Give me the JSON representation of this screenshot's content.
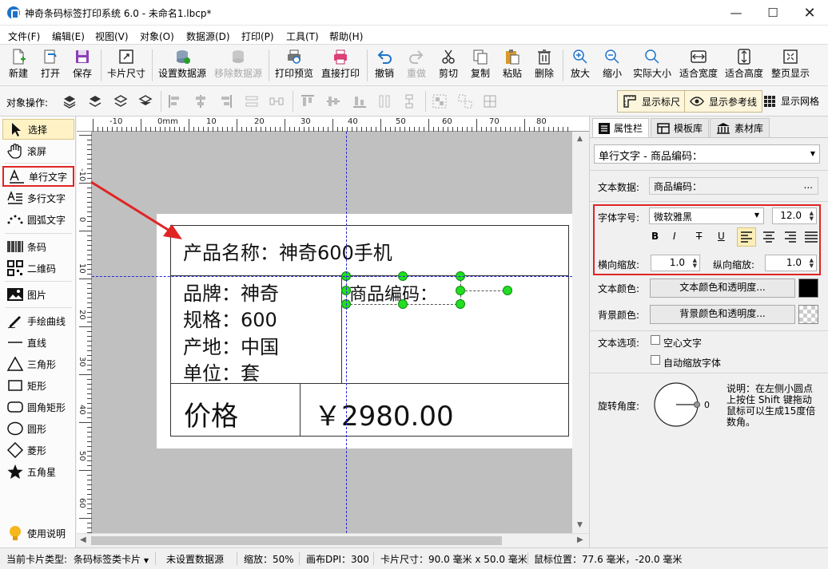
{
  "window": {
    "title": "神奇条码标签打印系统 6.0 - 未命名1.lbcp*"
  },
  "menu": [
    "文件(F)",
    "编辑(E)",
    "视图(V)",
    "对象(O)",
    "数据源(D)",
    "打印(P)",
    "工具(T)",
    "帮助(H)"
  ],
  "toolbar": [
    {
      "label": "新建",
      "icon": "new-file-icon",
      "enabled": true
    },
    {
      "label": "打开",
      "icon": "open-icon",
      "enabled": true
    },
    {
      "label": "保存",
      "icon": "save-icon",
      "enabled": true
    },
    {
      "label": "卡片尺寸",
      "icon": "card-size-icon",
      "enabled": true
    },
    {
      "label": "设置数据源",
      "icon": "database-icon",
      "enabled": true
    },
    {
      "label": "移除数据源",
      "icon": "remove-database-icon",
      "enabled": false
    },
    {
      "label": "打印预览",
      "icon": "print-preview-icon",
      "enabled": true
    },
    {
      "label": "直接打印",
      "icon": "printer-icon",
      "enabled": true
    },
    {
      "label": "撤销",
      "icon": "undo-icon",
      "enabled": true
    },
    {
      "label": "重做",
      "icon": "redo-icon",
      "enabled": false
    },
    {
      "label": "剪切",
      "icon": "scissors-icon",
      "enabled": true
    },
    {
      "label": "复制",
      "icon": "copy-icon",
      "enabled": true
    },
    {
      "label": "粘贴",
      "icon": "paste-icon",
      "enabled": true
    },
    {
      "label": "删除",
      "icon": "trash-icon",
      "enabled": true
    },
    {
      "label": "放大",
      "icon": "zoom-in-icon",
      "enabled": true
    },
    {
      "label": "缩小",
      "icon": "zoom-out-icon",
      "enabled": true
    },
    {
      "label": "实际大小",
      "icon": "actual-size-icon",
      "enabled": true
    },
    {
      "label": "适合宽度",
      "icon": "fit-width-icon",
      "enabled": true
    },
    {
      "label": "适合高度",
      "icon": "fit-height-icon",
      "enabled": true
    },
    {
      "label": "整页显示",
      "icon": "full-page-icon",
      "enabled": true
    }
  ],
  "objbar": {
    "label": "对象操作:",
    "toggles": [
      {
        "label": "显示标尺",
        "icon": "ruler-icon",
        "active": true
      },
      {
        "label": "显示参考线",
        "icon": "eye-icon",
        "active": true
      },
      {
        "label": "显示网格",
        "icon": "grid-icon",
        "active": false
      }
    ]
  },
  "tools": [
    {
      "label": "选择",
      "icon": "arrow-cursor-icon",
      "state": "selected"
    },
    {
      "label": "滚屏",
      "icon": "hand-icon",
      "state": ""
    },
    {
      "label": "单行文字",
      "icon": "single-line-text-icon",
      "state": "highlighted"
    },
    {
      "label": "多行文字",
      "icon": "multi-line-text-icon",
      "state": ""
    },
    {
      "label": "圆弧文字",
      "icon": "arc-text-icon",
      "state": ""
    },
    {
      "label": "条码",
      "icon": "barcode-icon",
      "state": ""
    },
    {
      "label": "二维码",
      "icon": "qrcode-icon",
      "state": ""
    },
    {
      "label": "图片",
      "icon": "image-icon",
      "state": ""
    },
    {
      "label": "手绘曲线",
      "icon": "pen-icon",
      "state": ""
    },
    {
      "label": "直线",
      "icon": "line-icon",
      "state": ""
    },
    {
      "label": "三角形",
      "icon": "triangle-icon",
      "state": ""
    },
    {
      "label": "矩形",
      "icon": "rectangle-icon",
      "state": ""
    },
    {
      "label": "圆角矩形",
      "icon": "rounded-rectangle-icon",
      "state": ""
    },
    {
      "label": "圆形",
      "icon": "circle-icon",
      "state": ""
    },
    {
      "label": "菱形",
      "icon": "diamond-icon",
      "state": ""
    },
    {
      "label": "五角星",
      "icon": "star-icon",
      "state": ""
    },
    {
      "label": "使用说明",
      "icon": "lightbulb-icon",
      "state": ""
    }
  ],
  "ruler": {
    "top": [
      "-10",
      "0mm",
      "10",
      "20",
      "30",
      "40",
      "50",
      "60",
      "70",
      "80"
    ],
    "left": [
      "-10",
      "0",
      "10",
      "20",
      "30",
      "40",
      "50",
      "60"
    ]
  },
  "card": {
    "product_name": "产品名称：神奇600手机",
    "brand": "品牌：神奇",
    "spec": "规格：600",
    "origin": "产地：中国",
    "unit": "单位：套",
    "selected_text": "商品编码：",
    "price_label": "价格",
    "price_value": "￥2980.00"
  },
  "right": {
    "tabs": [
      {
        "label": "属性栏",
        "icon": "list-icon",
        "active": true
      },
      {
        "label": "模板库",
        "icon": "template-icon",
        "active": false
      },
      {
        "label": "素材库",
        "icon": "library-icon",
        "active": false
      }
    ],
    "object_select": "单行文字 - 商品编码：",
    "text_data_label": "文本数据:",
    "text_data_value": "商品编码：",
    "text_data_more": "...",
    "font_label": "字体字号:",
    "font_name": "微软雅黑",
    "font_size": "12.0",
    "style_buttons": [
      "B",
      "I",
      "T",
      "U"
    ],
    "hscale_label": "横向缩放:",
    "hscale_value": "1.0",
    "vscale_label": "纵向缩放:",
    "vscale_value": "1.0",
    "text_color_label": "文本颜色:",
    "text_color_btn": "文本颜色和透明度...",
    "text_color": "#000000",
    "bg_color_label": "背景颜色:",
    "bg_color_btn": "背景颜色和透明度...",
    "text_options_label": "文本选项:",
    "hollow_text": "空心文字",
    "auto_scale": "自动缩放字体",
    "rotate_label": "旋转角度:",
    "rotate_value": "0",
    "rotate_note": "说明：在左侧小圆点上按住 Shift 键拖动鼠标可以生成15度倍数角。"
  },
  "status": {
    "card_type_label": "当前卡片类型:",
    "card_type_value": "条码标签类卡片",
    "datasource": "未设置数据源",
    "zoom": "缩放：50%",
    "dpi": "画布DPI：300",
    "card_size": "卡片尺寸：90.0 毫米 x 50.0 毫米",
    "mouse_pos": "鼠标位置：77.6 毫米，-20.0 毫米"
  },
  "colors": {
    "accent": "#1e73c8",
    "highlight": "#e02424",
    "handle": "#22dd22"
  }
}
